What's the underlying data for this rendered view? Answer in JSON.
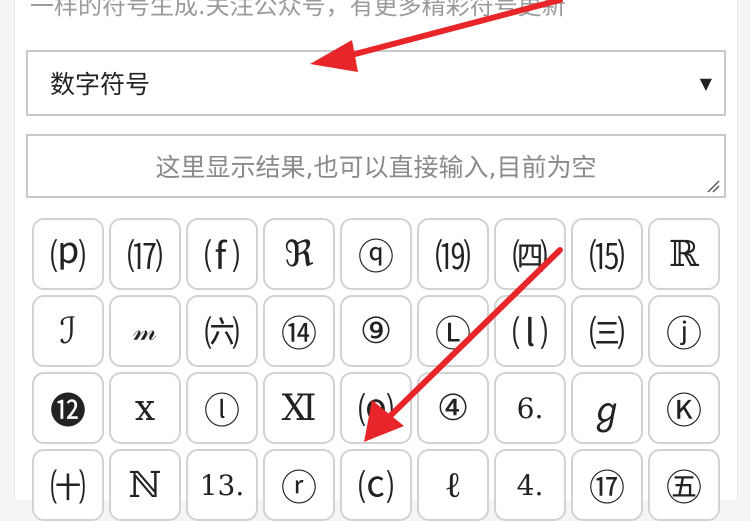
{
  "notice": "一样的符号生成.关注公众号，有更多精彩符号更新",
  "category_select": {
    "value": "数字符号",
    "caret": "▼"
  },
  "result_box": {
    "placeholder": "这里显示结果,也可以直接输入,目前为空"
  },
  "symbol_rows": [
    [
      "⒫",
      "⒄",
      "⒡",
      "ℜ",
      "ⓠ",
      "⒆",
      "㈣",
      "⒂",
      "ℝ"
    ],
    [
      "ℐ",
      "𝓂",
      "㈥",
      "⑭",
      "⑨",
      "Ⓛ",
      "⒧",
      "㈢",
      "ⓙ"
    ],
    [
      "⓬",
      "x",
      "ⓛ",
      "Ⅺ",
      "⒪",
      "④",
      "6.",
      "ℊ",
      "Ⓚ"
    ],
    [
      "㈩",
      "ℕ",
      "13.",
      "ⓡ",
      "⒞",
      "ℓ",
      "4.",
      "⑰",
      "㊄"
    ]
  ],
  "colors": {
    "arrow": "#e8262a",
    "key_border": "#d2d2d2",
    "text": "#222222",
    "placeholder": "#8a8a8a"
  }
}
